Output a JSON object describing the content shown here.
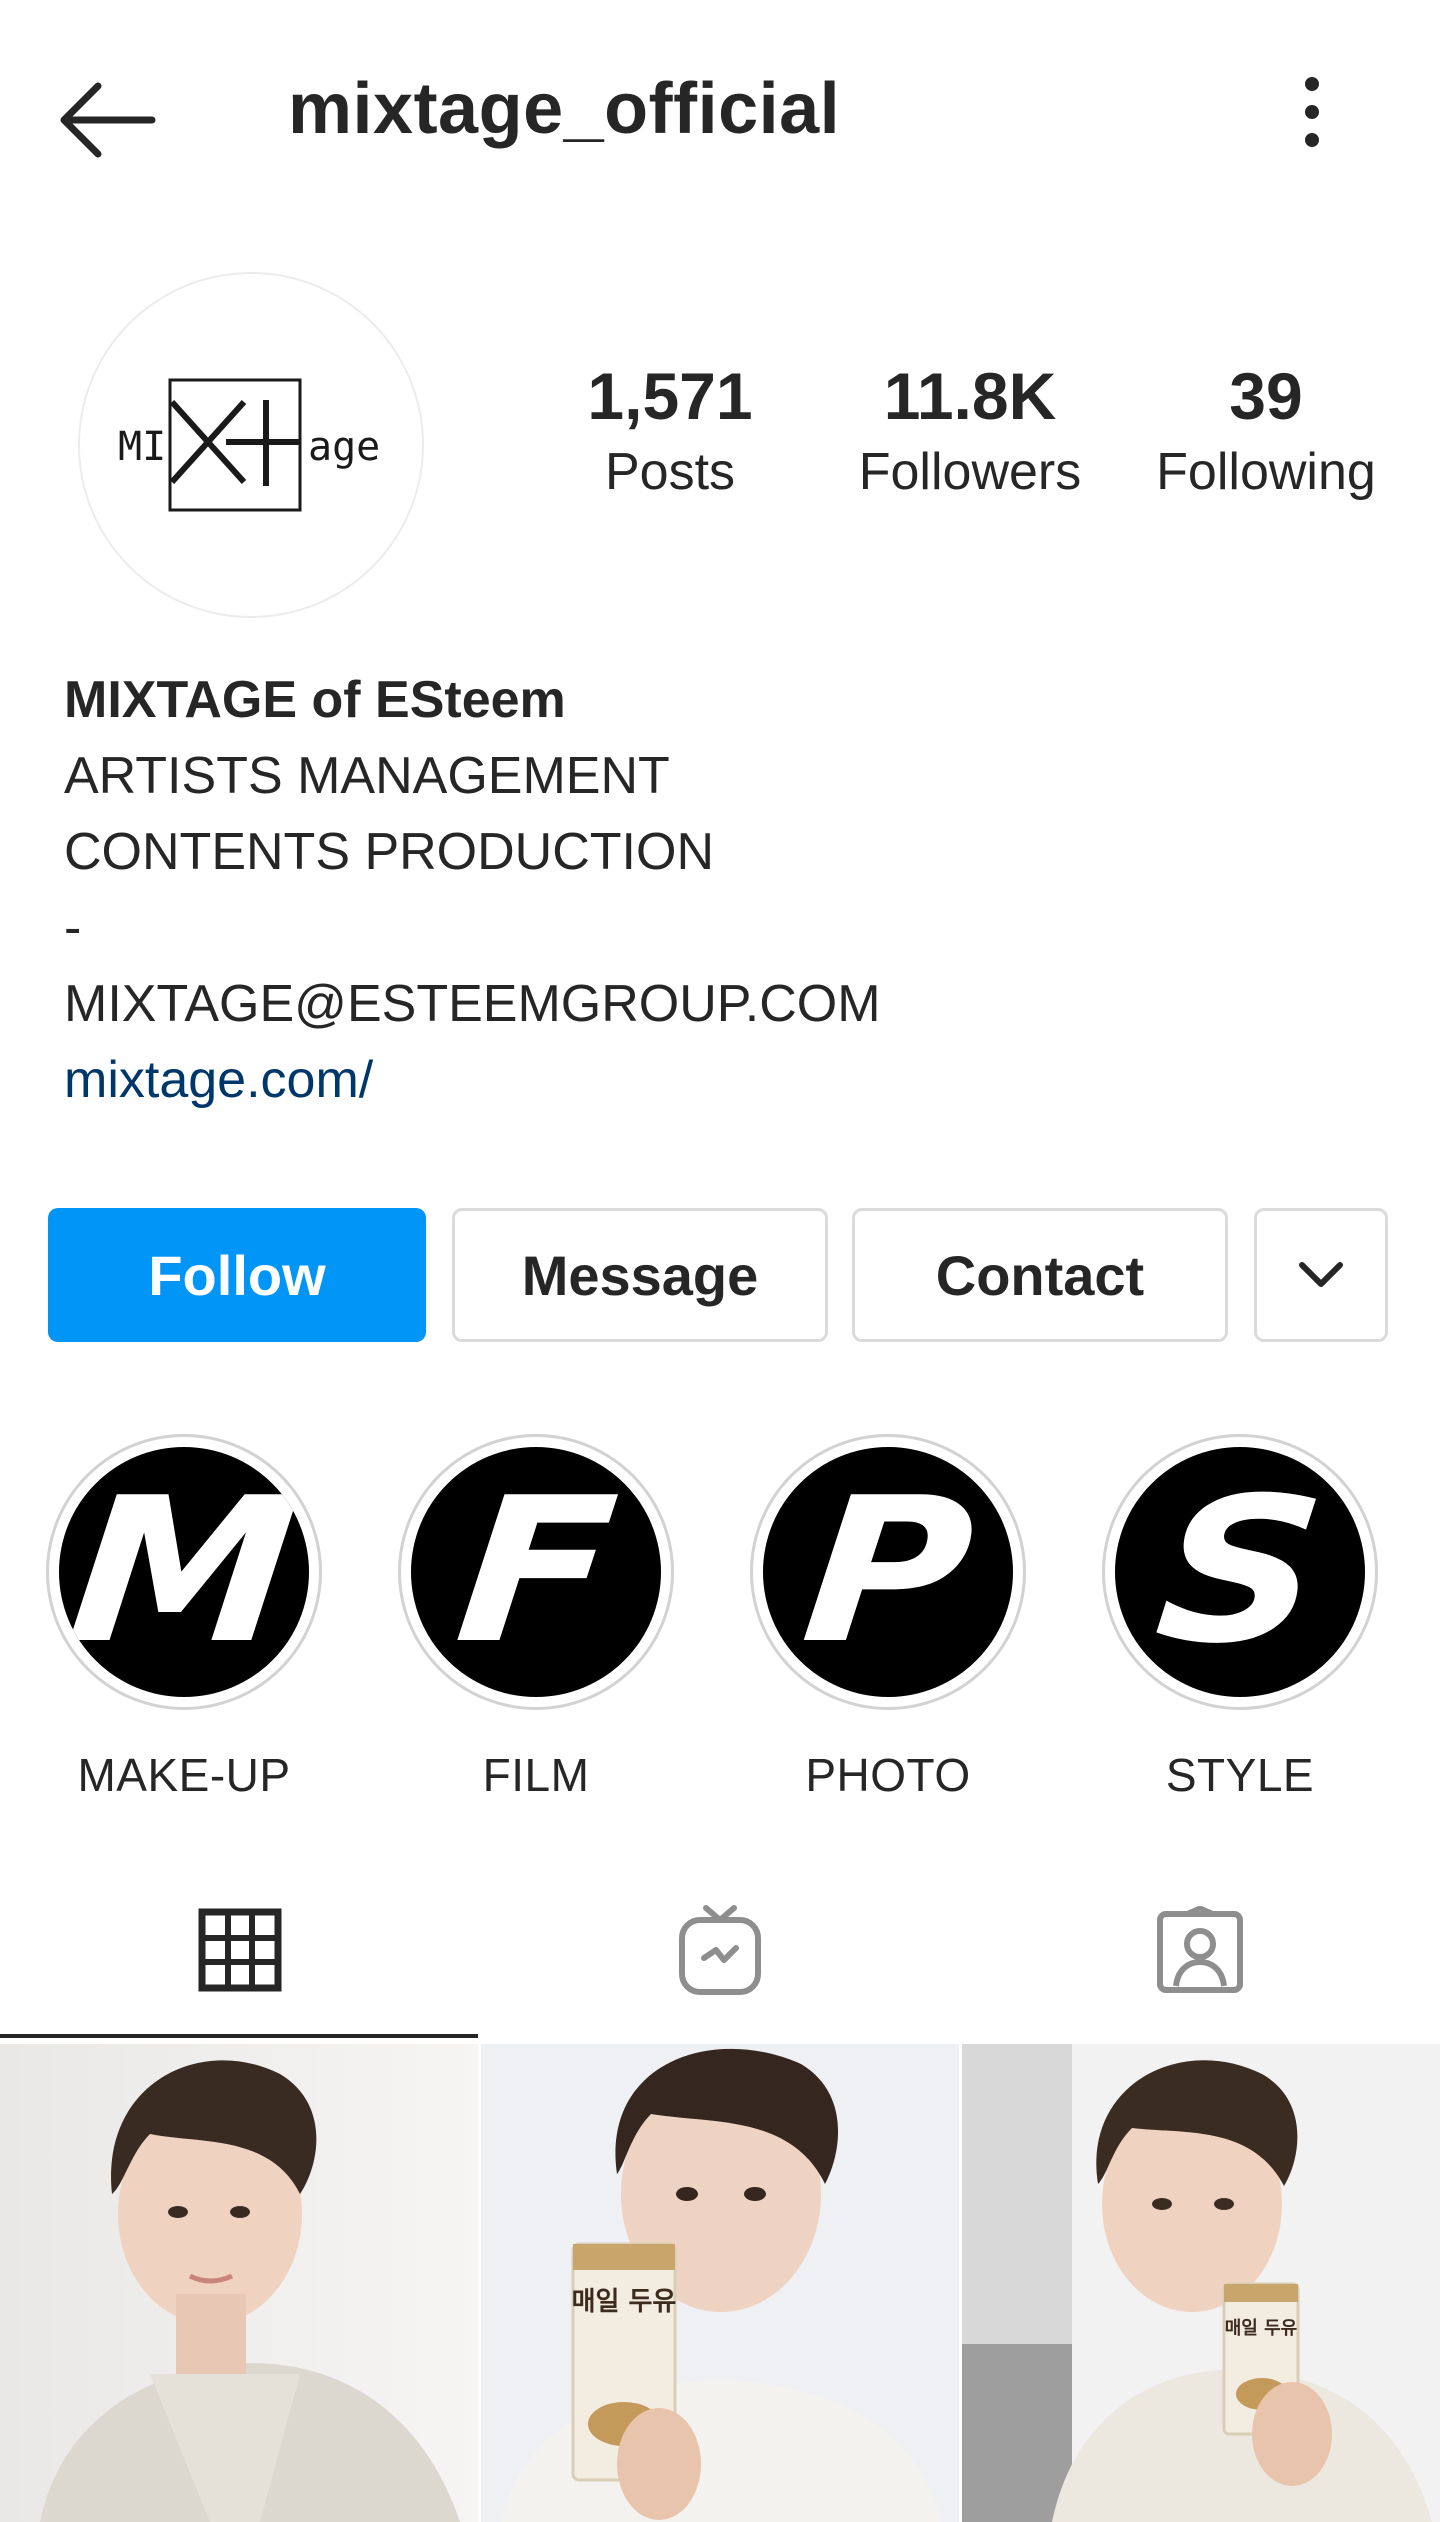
{
  "header": {
    "username": "mixtage_official",
    "back_icon": "arrow-left-icon",
    "menu_icon": "more-vertical-icon"
  },
  "profile": {
    "avatar_logo": {
      "left": "MI",
      "mark": "X+",
      "right": "age"
    },
    "stats": [
      {
        "value": "1,571",
        "label": "Posts"
      },
      {
        "value": "11.8K",
        "label": "Followers"
      },
      {
        "value": "39",
        "label": "Following"
      }
    ]
  },
  "bio": {
    "name": "MIXTAGE of ESteem",
    "lines": [
      "ARTISTS MANAGEMENT",
      "CONTENTS PRODUCTION",
      "-",
      "MIXTAGE@ESTEEMGROUP.COM"
    ],
    "link": "mixtage.com/"
  },
  "actions": {
    "follow": "Follow",
    "message": "Message",
    "contact": "Contact",
    "more_icon": "chevron-down-icon"
  },
  "highlights": [
    {
      "letter": "M",
      "label": "MAKE-UP"
    },
    {
      "letter": "F",
      "label": "FILM"
    },
    {
      "letter": "P",
      "label": "PHOTO"
    },
    {
      "letter": "S",
      "label": "STYLE"
    }
  ],
  "tabs": [
    {
      "icon": "grid-icon",
      "active": true
    },
    {
      "icon": "igtv-icon",
      "active": false
    },
    {
      "icon": "tagged-user-icon",
      "active": false
    }
  ],
  "posts": [
    {
      "packaging_text": ""
    },
    {
      "packaging_text": "매일 두유"
    },
    {
      "packaging_text": "매일 두유"
    }
  ],
  "colors": {
    "primary_button": "#0095f6",
    "text": "#262626",
    "link": "#00376b",
    "border": "#dbdbdb"
  }
}
